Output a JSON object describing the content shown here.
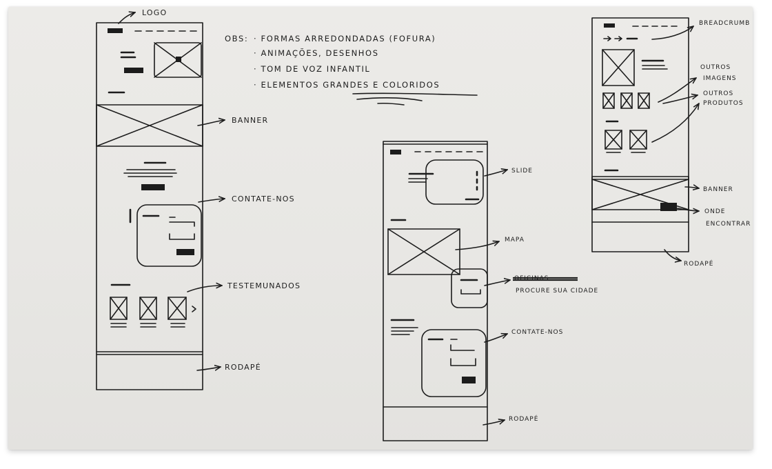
{
  "left_wireframe": {
    "logo": "LOGO",
    "banner": "BANNER",
    "contact": "CONTATE-NOS",
    "testimonials": "TESTEMUNADOS",
    "footer": "RODAPÉ"
  },
  "notes": {
    "heading": "OBS:",
    "items": [
      "· FORMAS ARREDONDADAS (FOFURA)",
      "· ANIMAÇÕES, DESENHOS",
      "· TOM DE VOZ INFANTIL",
      "· ELEMENTOS GRANDES E COLORIDOS"
    ]
  },
  "middle_wireframe": {
    "slide": "SLIDE",
    "map": "MAPA",
    "struck_word": "OFICINAS",
    "find_city": "PROCURE SUA CIDADE",
    "contact": "CONTATE-NOS",
    "footer": "RODAPÉ"
  },
  "right_wireframe": {
    "breadcrumb": "BREADCRUMB",
    "other_images_1": "OUTROS",
    "other_images_2": "IMAGENS",
    "other_products_1": "OUTROS",
    "other_products_2": "PRODUTOS",
    "banner": "BANNER",
    "where_1": "ONDE",
    "where_2": "ENCONTRAR",
    "footer": "RODAPÉ"
  }
}
